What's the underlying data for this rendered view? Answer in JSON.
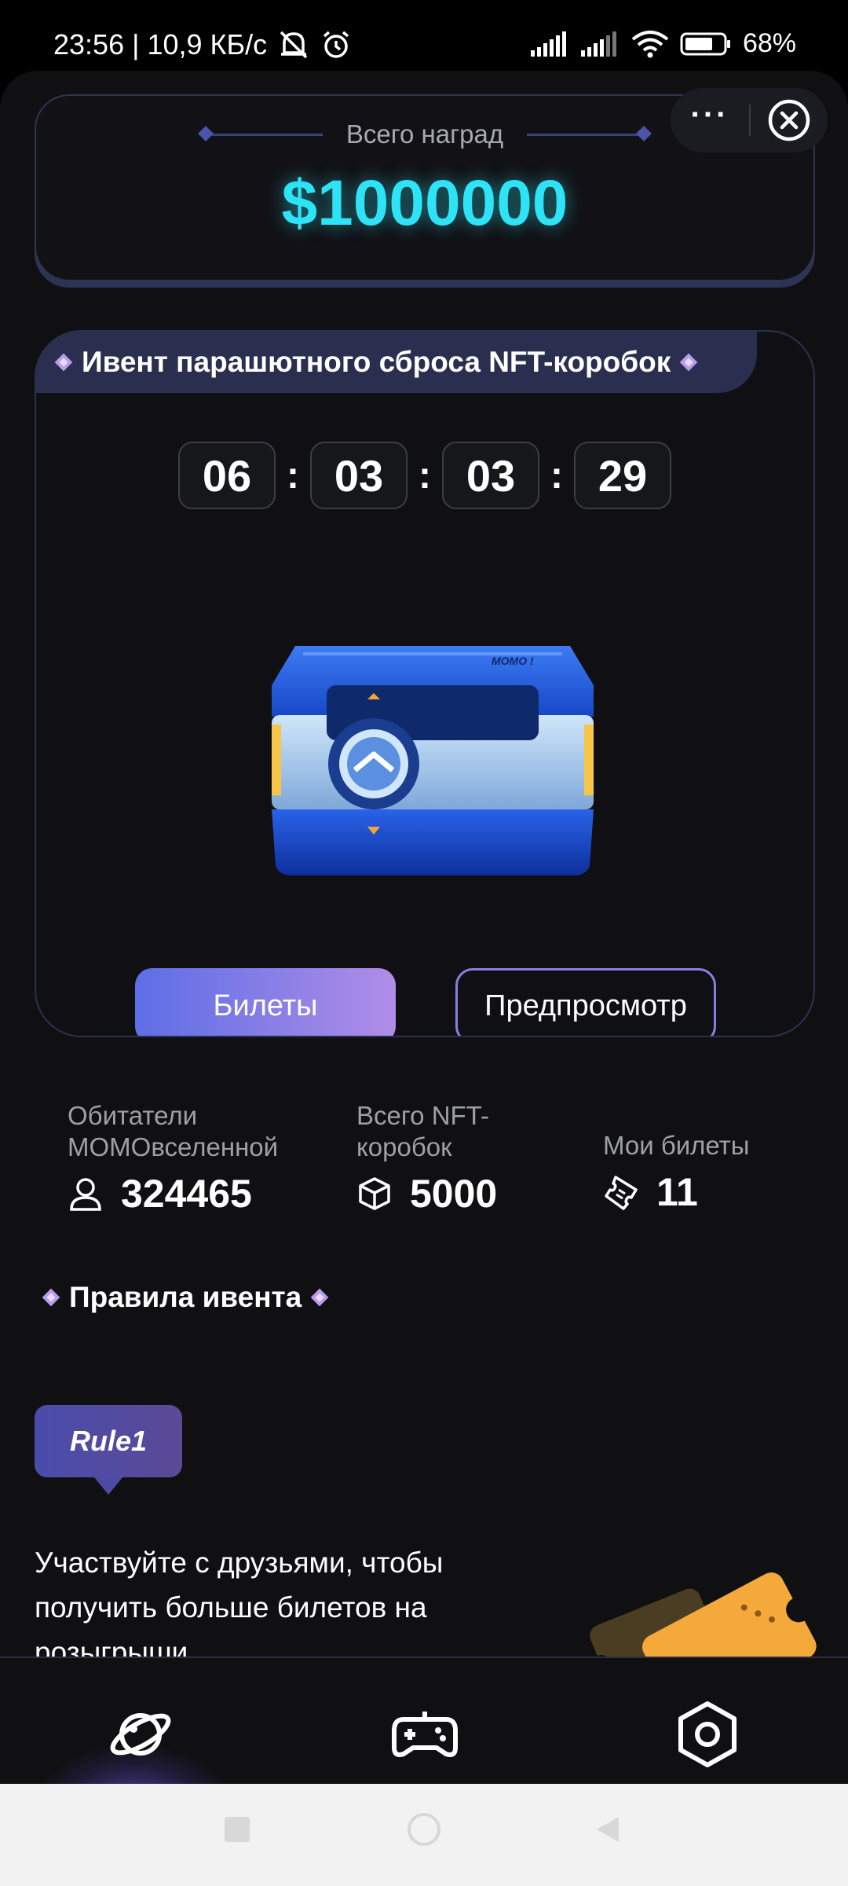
{
  "status_bar": {
    "time_speed": "23:56 | 10,9 КБ/с",
    "battery": "68%",
    "icons": [
      "muted-bell-icon",
      "alarm-icon",
      "signal-icon",
      "signal-icon",
      "wifi-icon",
      "battery-icon"
    ]
  },
  "capsule": {
    "more_icon": "more-dots-icon",
    "close_icon": "close-circle-icon"
  },
  "prize": {
    "label": "Всего наград",
    "amount": "$1000000"
  },
  "event": {
    "title": "Ивент парашютного сброса NFT-коробок",
    "timer": {
      "d": "06",
      "h": "03",
      "m": "03",
      "s": "29",
      "sep": ":"
    },
    "tickets_button": "Билеты",
    "preview_button": "Предпросмотр"
  },
  "stats": {
    "residents": {
      "label": "Обитатели МОМОвселенной",
      "value": "324465",
      "icon": "user-icon"
    },
    "boxes": {
      "label": "Всего NFT-коробок",
      "value": "5000",
      "icon": "cube-icon"
    },
    "my_tickets": {
      "label": "Мои билеты",
      "value": "11",
      "icon": "ticket-icon"
    }
  },
  "rules": {
    "title": "Правила ивента",
    "badge": "Rule1",
    "text": "Участвуйте с друзьями, чтобы получить больше билетов на розыгрыши"
  },
  "bottom_nav": [
    "planet-icon",
    "gamepad-icon",
    "settings-icon"
  ],
  "colors": {
    "accent": "#2ee3f5",
    "purple": "#b08de8",
    "blue": "#5d6ee6",
    "bg": "#101012"
  }
}
